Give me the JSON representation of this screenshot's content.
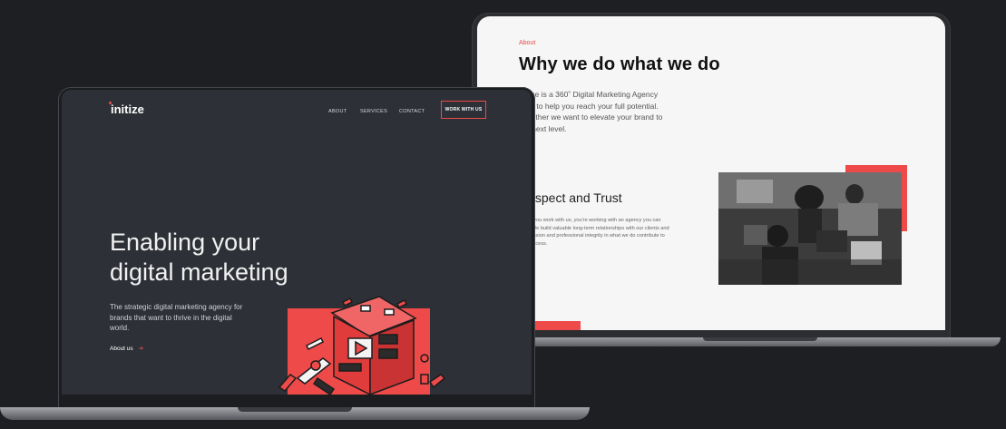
{
  "back_page": {
    "eyebrow": "About",
    "title": "Why we do what we do",
    "body": "Initize is a 360˚ Digital Marketing Agency here to help you reach your full potential. Together we want to elevate your brand to the next level.",
    "section_title": "Respect and Trust",
    "section_body": "When you work with us, you're working with an agency you can trust. We build valuable long-term relationships with our clients and our passion and professional integrity in what we do contribute to our success."
  },
  "front_page": {
    "logo": "initize",
    "nav": [
      "ABOUT",
      "SERVICES",
      "CONTACT"
    ],
    "cta": "WORK WITH US",
    "hero_title_line1": "Enabling your",
    "hero_title_line2": "digital marketing",
    "hero_subtitle": "The strategic digital marketing agency for brands that want to thrive in the digital world.",
    "hero_link": "About us",
    "hero_link_arrow": "➔"
  },
  "colors": {
    "accent": "#ef4a4a",
    "dark_bg": "#2d3036",
    "light_bg": "#f6f6f6"
  }
}
